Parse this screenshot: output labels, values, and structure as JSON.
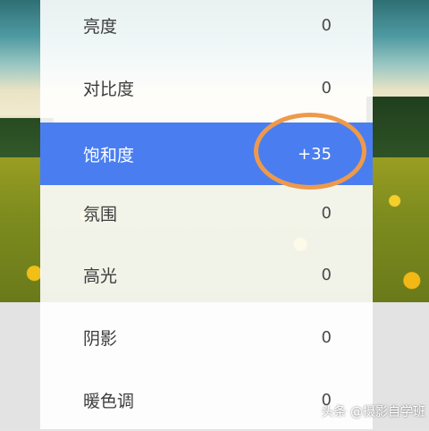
{
  "adjust_list": {
    "items": [
      {
        "label": "亮度",
        "value": "0"
      },
      {
        "label": "对比度",
        "value": "0"
      },
      {
        "label": "饱和度",
        "value": "+35",
        "selected": true
      },
      {
        "label": "氛围",
        "value": "0"
      },
      {
        "label": "高光",
        "value": "0"
      },
      {
        "label": "阴影",
        "value": "0"
      },
      {
        "label": "暖色调",
        "value": "0"
      }
    ]
  },
  "colors": {
    "selected_row": "#4a7ef0",
    "highlight_ellipse": "#ee9a4a"
  },
  "watermark": "头条 @摄影自学班"
}
